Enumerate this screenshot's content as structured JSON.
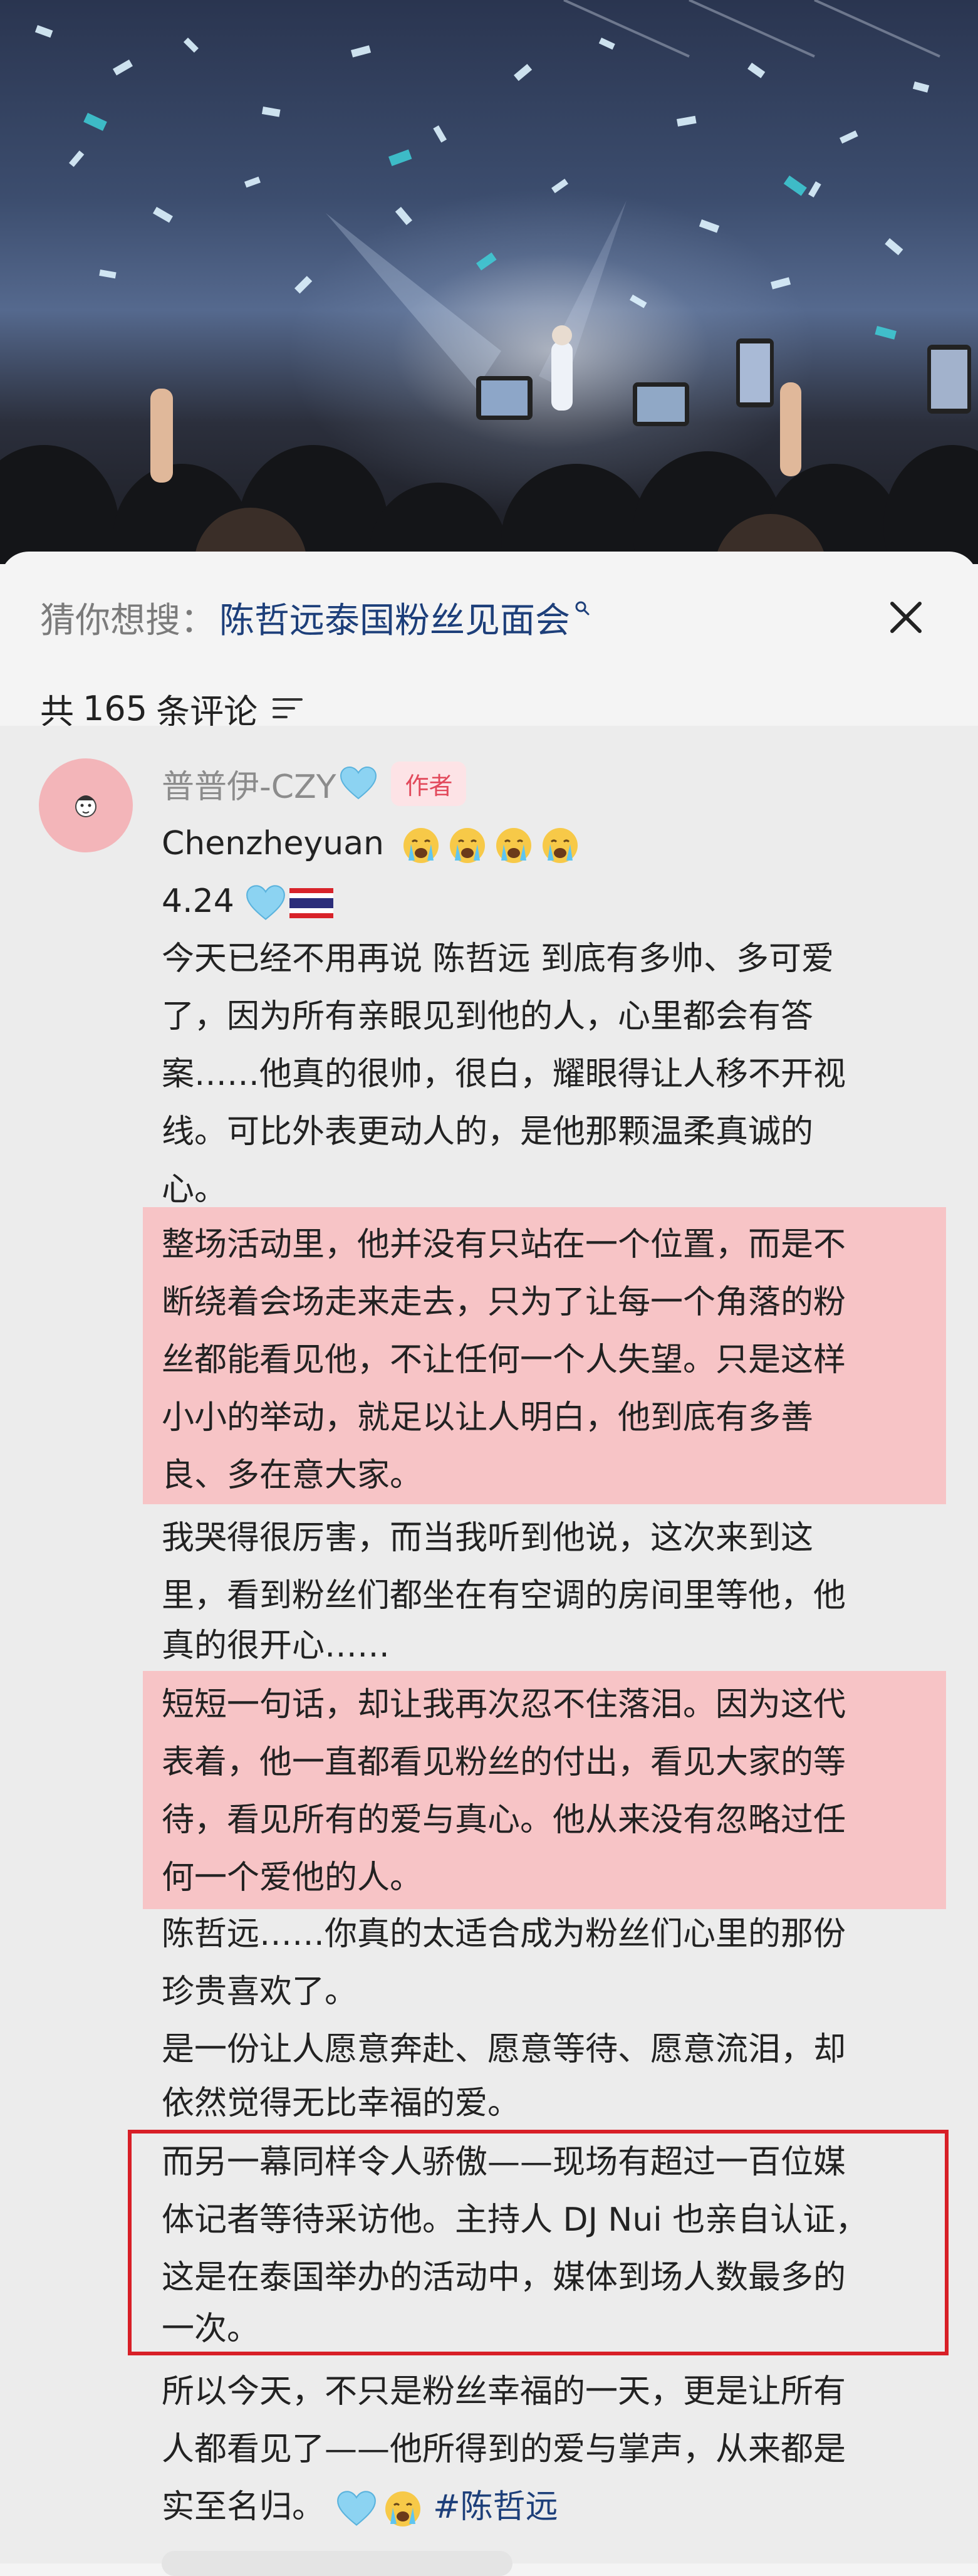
{
  "search": {
    "prefix": "猜你想搜：",
    "term": "陈哲远泰国粉丝见面会"
  },
  "comments_header": {
    "prefix": "共",
    "count": "165",
    "suffix": "条评论"
  },
  "comment": {
    "username": "普普伊-CZY",
    "author_badge": "作者",
    "name_line": "Chenzheyuan",
    "date_line": "4.24",
    "lines": [
      "今天已经不用再说 陈哲远 到底有多帅、多可爱",
      "了，因为所有亲眼见到他的人，心里都会有答",
      "案……他真的很帅，很白，耀眼得让人移不开视",
      "线。可比外表更动人的，是他那颗温柔真诚的",
      "心。",
      "整场活动里，他并没有只站在一个位置，而是不",
      "断绕着会场走来走去，只为了让每一个角落的粉",
      "丝都能看见他，不让任何一个人失望。只是这样",
      "小小的举动，就足以让人明白，他到底有多善",
      "良、多在意大家。",
      "我哭得很厉害，而当我听到他说，这次来到这",
      "里，看到粉丝们都坐在有空调的房间里等他，他",
      "真的很开心……",
      "短短一句话，却让我再次忍不住落泪。因为这代",
      "表着，他一直都看见粉丝的付出，看见大家的等",
      "待，看见所有的爱与真心。他从来没有忽略过任",
      "何一个爱他的人。",
      "陈哲远……你真的太适合成为粉丝们心里的那份",
      "珍贵喜欢了。",
      "是一份让人愿意奔赴、愿意等待、愿意流泪，却",
      "依然觉得无比幸福的爱。",
      "而另一幕同样令人骄傲——现场有超过一百位媒",
      "体记者等待采访他。主持人 DJ Nui 也亲自认证，",
      "这是在泰国举办的活动中，媒体到场人数最多的",
      "一次。",
      "所以今天，不只是粉丝幸福的一天，更是让所有",
      "人都看见了——他所得到的爱与掌声，从来都是",
      "实至名归。"
    ],
    "hashtag": "#陈哲远"
  },
  "colors": {
    "highlight": "#f7c4c6",
    "redbox": "#d81f27",
    "hashtag": "#1d3f7a",
    "badge_text": "#e2495b"
  }
}
